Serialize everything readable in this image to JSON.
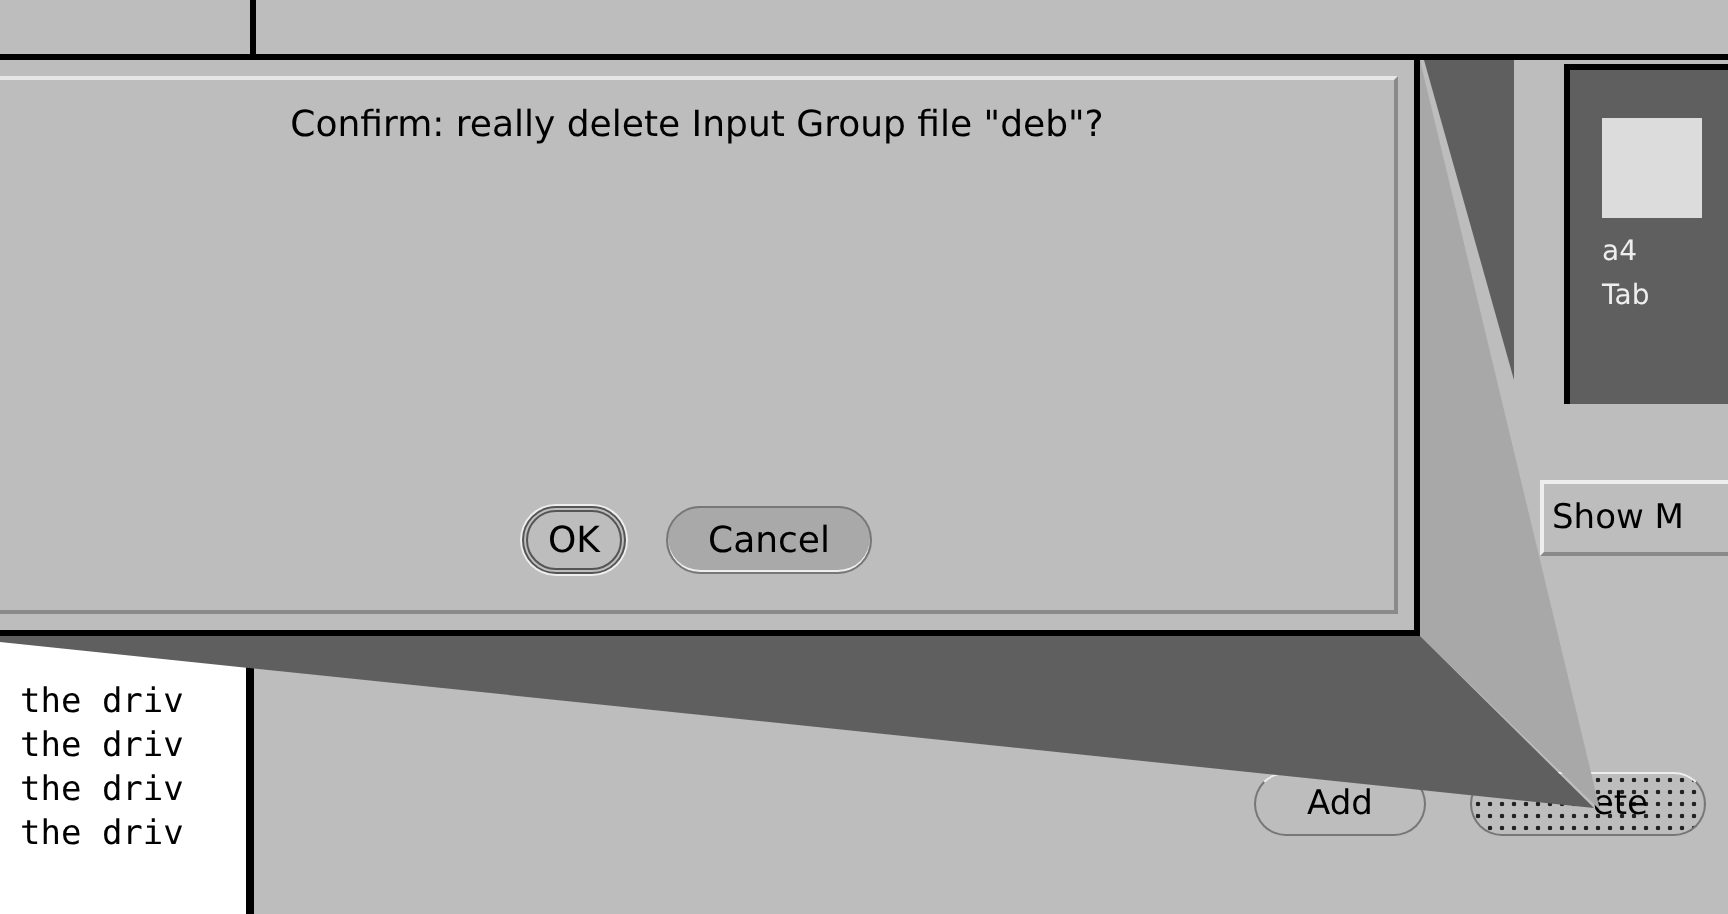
{
  "dialog": {
    "message": "Confirm: really delete Input Group file \"deb\"?",
    "buttons": [
      {
        "label": "OK",
        "default": true
      },
      {
        "label": "Cancel",
        "default": false
      }
    ]
  },
  "file_list": [
    "the driv",
    "the driv",
    "the driv",
    "the driv"
  ],
  "icon_tile": {
    "lines": [
      "a4",
      "Tab"
    ]
  },
  "show_button": "Show M",
  "actions": [
    {
      "label": "Add",
      "busy": false
    },
    {
      "label": "ete",
      "busy": true
    }
  ]
}
